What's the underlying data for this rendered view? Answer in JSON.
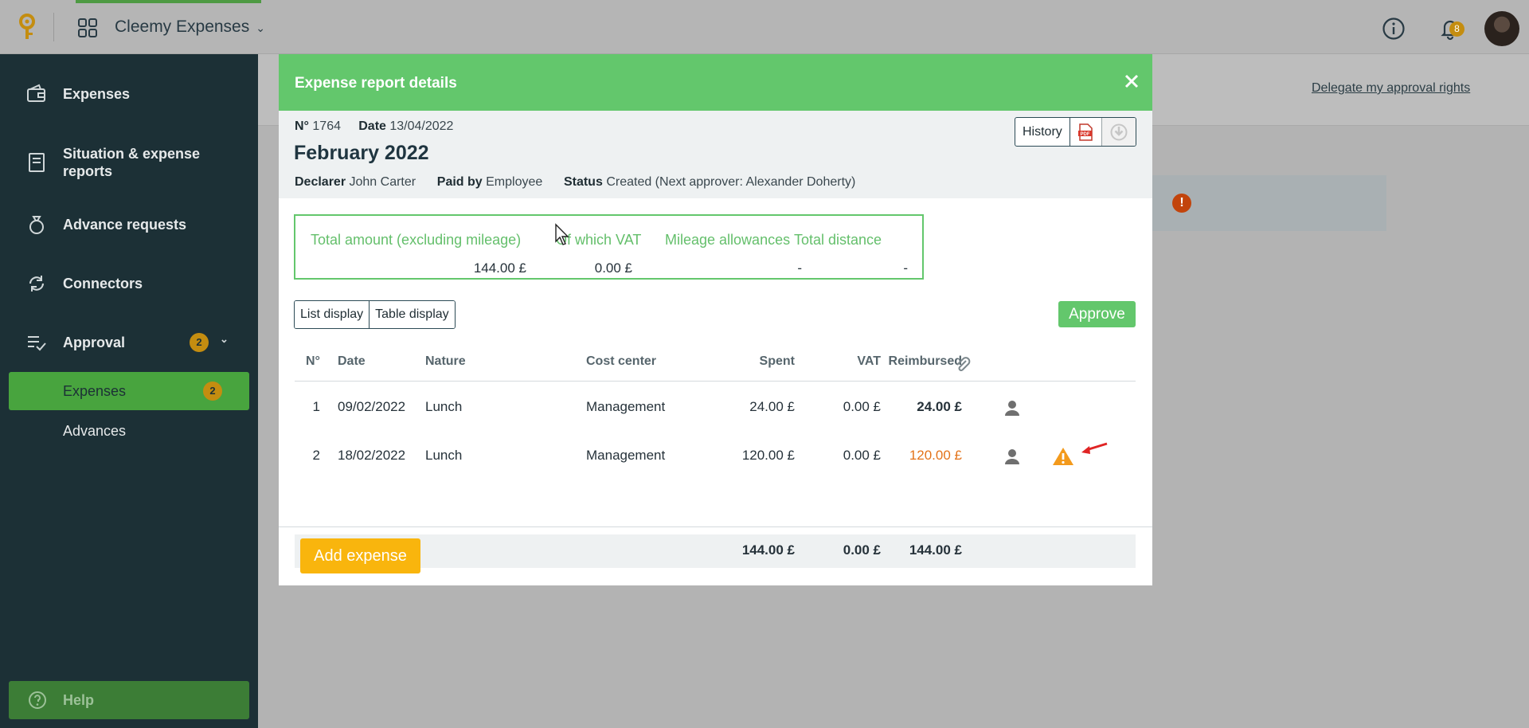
{
  "app": {
    "title": "Cleemy Expenses",
    "notification_count": "8"
  },
  "sidebar": {
    "items": [
      {
        "label": "Expenses",
        "icon": "wallet-icon"
      },
      {
        "label": "Situation & expense reports",
        "icon": "receipt-icon"
      },
      {
        "label": "Advance requests",
        "icon": "money-bag-icon"
      },
      {
        "label": "Connectors",
        "icon": "sync-icon"
      },
      {
        "label": "Approval",
        "icon": "checklist-icon",
        "badge": "2"
      }
    ],
    "subitems": [
      {
        "label": "Expenses",
        "badge": "2",
        "active": true
      },
      {
        "label": "Advances"
      }
    ],
    "help_label": "Help"
  },
  "background": {
    "delegate_link": "Delegate my approval rights",
    "alert_glyph": "!"
  },
  "modal": {
    "title": "Expense report details",
    "number_label": "N°",
    "number": "1764",
    "date_label": "Date",
    "date": "13/04/2022",
    "report_title": "February 2022",
    "declarer_label": "Declarer",
    "declarer": "John Carter",
    "paid_by_label": "Paid by",
    "paid_by": "Employee",
    "status_label": "Status",
    "status": "Created (Next approver: Alexander Doherty)",
    "history_label": "History",
    "totals": {
      "headers": [
        "Total amount (excluding mileage)",
        "Of which VAT",
        "Mileage allowances",
        "Total distance"
      ],
      "values": [
        "144.00 £",
        "0.00 £",
        "-",
        "-"
      ]
    },
    "display_options": [
      "List display",
      "Table display"
    ],
    "approve_label": "Approve",
    "table": {
      "headers": [
        "N°",
        "Date",
        "Nature",
        "Cost center",
        "Spent",
        "VAT",
        "Reimbursed"
      ],
      "rows": [
        {
          "n": "1",
          "date": "09/02/2022",
          "nature": "Lunch",
          "cost_center": "Management",
          "spent": "24.00 £",
          "vat": "0.00 £",
          "reimbursed": "24.00 £",
          "warning": false
        },
        {
          "n": "2",
          "date": "18/02/2022",
          "nature": "Lunch",
          "cost_center": "Management",
          "spent": "120.00 £",
          "vat": "0.00 £",
          "reimbursed": "120.00 £",
          "warning": true
        }
      ],
      "totals": {
        "spent": "144.00 £",
        "vat": "0.00 £",
        "reimbursed": "144.00 £"
      }
    },
    "add_expense_label": "Add expense"
  },
  "colors": {
    "primary_green": "#63c76c",
    "sidebar_bg": "#1c3036",
    "accent_yellow": "#f9b50d",
    "warning_orange": "#e3731a",
    "badge_gold": "#c48d10"
  }
}
